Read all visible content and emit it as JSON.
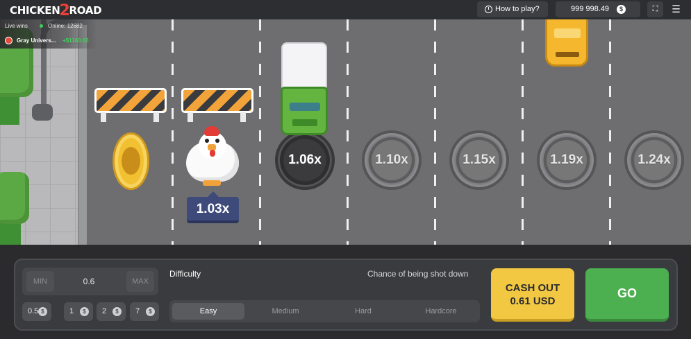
{
  "header": {
    "logo_text_a": "CHICKEN",
    "logo_text_b": "2",
    "logo_text_c": "ROAD",
    "how_to_play": "How to play?",
    "balance": "999 998.49",
    "currency_symbol": "$",
    "fullscreen_icon": "fullscreen-icon",
    "menu_icon": "hamburger-menu-icon"
  },
  "live_feed": {
    "label": "Live wins",
    "online_label": "Online: 12682",
    "player": "Gray Univers...",
    "win": "+$1100.00"
  },
  "game": {
    "current_multiplier": "1.03x",
    "multipliers": [
      "1.06x",
      "1.10x",
      "1.15x",
      "1.19x",
      "1.24x"
    ]
  },
  "controls": {
    "min_label": "MIN",
    "bet_value": "0.6",
    "max_label": "MAX",
    "quick_bets": [
      "0.5",
      "1",
      "2",
      "7"
    ],
    "difficulty_label": "Difficulty",
    "chance_label": "Chance of being shot down",
    "difficulties": [
      "Easy",
      "Medium",
      "Hard",
      "Hardcore"
    ],
    "selected_difficulty": "Easy",
    "cash_out_line1": "CASH OUT",
    "cash_out_line2": "0.61 USD",
    "go_label": "GO"
  },
  "colors": {
    "cash_out": "#f2c843",
    "go": "#4caf50",
    "win_green": "#3fcf5a",
    "multiplier_tag": "#3e4b7a"
  }
}
